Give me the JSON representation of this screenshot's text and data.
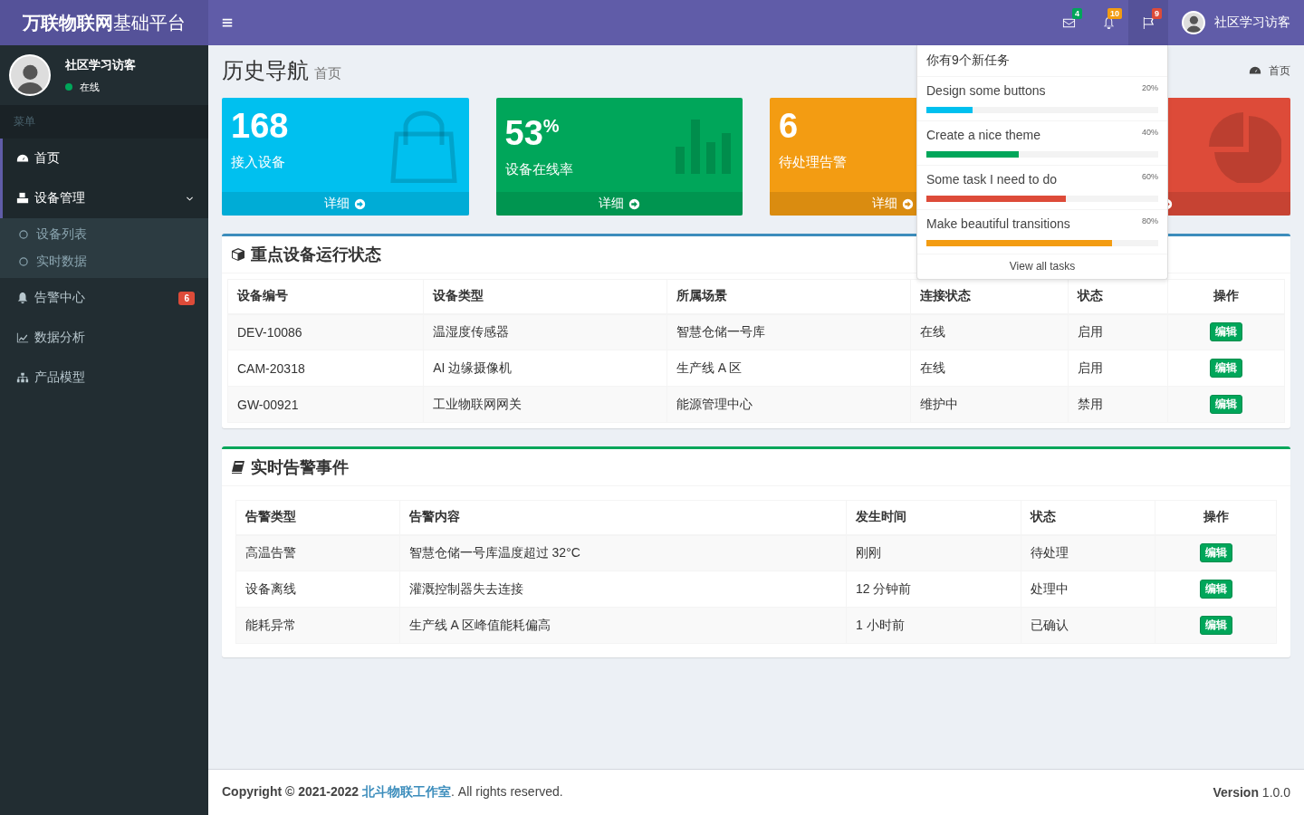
{
  "logo": {
    "bold": "万联物联网",
    "light": "基础平台"
  },
  "navbar": {
    "notifications": [
      {
        "kind": "mail",
        "count": "4",
        "color": "#00a65a",
        "selected": false
      },
      {
        "kind": "bell",
        "count": "10",
        "color": "#f39c12",
        "selected": false
      },
      {
        "kind": "flag",
        "count": "9",
        "color": "#dd4b39",
        "selected": true
      }
    ],
    "user": "社区学习访客"
  },
  "sidebar": {
    "user": {
      "name": "社区学习访客",
      "status": "在线"
    },
    "header": "菜单",
    "items": [
      {
        "label": "首页",
        "selected": true
      },
      {
        "label": "设备管理",
        "selected": true,
        "expanded": true,
        "children": [
          {
            "label": "设备列表"
          },
          {
            "label": "实时数据"
          }
        ]
      },
      {
        "label": "告警中心",
        "selected": false,
        "badge": "6"
      },
      {
        "label": "数据分析",
        "selected": false
      },
      {
        "label": "产品模型",
        "selected": false
      }
    ]
  },
  "page": {
    "title": "历史导航",
    "subtitle": "首页",
    "breadcrumb": "首页"
  },
  "cards": [
    {
      "value": "168",
      "label": "接入设备",
      "link": "详细",
      "color": "#00c0ef"
    },
    {
      "value": "53",
      "unit": "%",
      "label": "设备在线率",
      "link": "详细",
      "color": "#00a65a"
    },
    {
      "value": "6",
      "label": "待处理告警",
      "link": "详细",
      "color": "#f39c12"
    },
    {
      "color": "#dd4b39"
    }
  ],
  "devices": {
    "title": "重点设备运行状态",
    "color": "#3c8dbc",
    "columns": [
      "设备编号",
      "设备类型",
      "所属场景",
      "连接状态",
      "状态",
      "操作"
    ],
    "rows": [
      [
        "DEV-10086",
        "温湿度传感器",
        "智慧仓储一号库",
        "在线",
        "启用",
        "编辑"
      ],
      [
        "CAM-20318",
        "AI 边缘摄像机",
        "生产线 A 区",
        "在线",
        "启用",
        "编辑"
      ],
      [
        "GW-00921",
        "工业物联网网关",
        "能源管理中心",
        "维护中",
        "禁用",
        "编辑"
      ]
    ]
  },
  "alerts": {
    "title": "实时告警事件",
    "color": "#00a65a",
    "columns": [
      "告警类型",
      "告警内容",
      "发生时间",
      "状态",
      "操作"
    ],
    "rows": [
      [
        "高温告警",
        "智慧仓储一号库温度超过 32°C",
        "刚刚",
        "待处理",
        "编辑"
      ],
      [
        "设备离线",
        "灌溉控制器失去连接",
        "12 分钟前",
        "处理中",
        "编辑"
      ],
      [
        "能耗异常",
        "生产线 A 区峰值能耗偏高",
        "1 小时前",
        "已确认",
        "编辑"
      ]
    ]
  },
  "tasks": {
    "header": "你有9个新任务",
    "footer": "View all tasks",
    "items": [
      {
        "title": "Design some buttons",
        "percent": "20%",
        "level": 0.2,
        "color": "#00c0ef"
      },
      {
        "title": "Create a nice theme",
        "percent": "40%",
        "level": 0.4,
        "color": "#00a65a"
      },
      {
        "title": "Some task I need to do",
        "percent": "60%",
        "level": 0.6,
        "color": "#dd4b39"
      },
      {
        "title": "Make beautiful transitions",
        "percent": "80%",
        "level": 0.8,
        "color": "#f39c12"
      }
    ]
  },
  "footer": {
    "copyright": "**Copyright © 2021-2022**",
    "company": "北斗物联工作室",
    "rights": ". All rights reserved.",
    "version": "**Version** 1.0.0"
  }
}
